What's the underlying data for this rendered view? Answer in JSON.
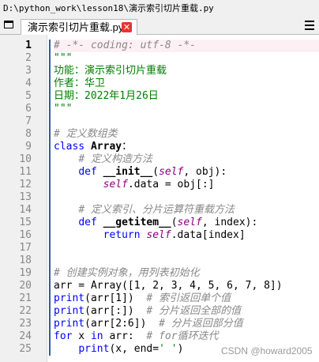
{
  "window": {
    "title": "D:\\python_work\\lesson18\\演示索引切片重载.py"
  },
  "tab": {
    "label": "演示索引切片重载.py",
    "close_glyph": "✕"
  },
  "colors": {
    "keyword": "#0000ff",
    "comment": "#888888",
    "string": "#008000",
    "self": "#8b0082",
    "current_line_bg": "#fdf0f5"
  },
  "icons": {
    "doclist": "document-list-icon",
    "menu": "hamburger-menu-icon",
    "close": "close-icon"
  },
  "editor": {
    "current_line": 1,
    "lines": [
      {
        "n": "1",
        "t": [
          [
            "cm",
            "# -*- coding: utf-8 -*-"
          ]
        ]
      },
      {
        "n": "2",
        "t": [
          [
            "st",
            "\"\"\""
          ]
        ]
      },
      {
        "n": "3",
        "t": [
          [
            "st",
            "功能：演示索引切片重载"
          ]
        ]
      },
      {
        "n": "4",
        "t": [
          [
            "st",
            "作者：华卫"
          ]
        ]
      },
      {
        "n": "5",
        "t": [
          [
            "st",
            "日期：2022年1月26日"
          ]
        ]
      },
      {
        "n": "6",
        "t": [
          [
            "st",
            "\"\"\""
          ]
        ]
      },
      {
        "n": "7",
        "t": []
      },
      {
        "n": "8",
        "t": [
          [
            "cm",
            "# 定义数组类"
          ]
        ]
      },
      {
        "n": "9",
        "t": [
          [
            "kw",
            "class "
          ],
          [
            "dn",
            "Array"
          ],
          [
            "",
            "："
          ]
        ]
      },
      {
        "n": "10",
        "t": [
          [
            "",
            "    "
          ],
          [
            "cm",
            "# 定义构造方法"
          ]
        ]
      },
      {
        "n": "11",
        "t": [
          [
            "",
            "    "
          ],
          [
            "kw",
            "def "
          ],
          [
            "dn",
            "__init__"
          ],
          [
            "",
            "("
          ],
          [
            "se",
            "self"
          ],
          [
            "",
            ", obj):"
          ]
        ]
      },
      {
        "n": "12",
        "t": [
          [
            "",
            "        "
          ],
          [
            "se",
            "self"
          ],
          [
            "",
            ".data = obj[:]"
          ]
        ]
      },
      {
        "n": "13",
        "t": []
      },
      {
        "n": "14",
        "t": [
          [
            "",
            "    "
          ],
          [
            "cm",
            "# 定义索引、分片运算符重载方法"
          ]
        ]
      },
      {
        "n": "15",
        "t": [
          [
            "",
            "    "
          ],
          [
            "kw",
            "def "
          ],
          [
            "dn",
            "__getitem__"
          ],
          [
            "",
            "("
          ],
          [
            "se",
            "self"
          ],
          [
            "",
            ", index):"
          ]
        ]
      },
      {
        "n": "16",
        "t": [
          [
            "",
            "        "
          ],
          [
            "kw",
            "return "
          ],
          [
            "se",
            "self"
          ],
          [
            "",
            ".data[index]"
          ]
        ]
      },
      {
        "n": "17",
        "t": []
      },
      {
        "n": "18",
        "t": []
      },
      {
        "n": "19",
        "t": [
          [
            "cm",
            "# 创建实例对象，用列表初始化"
          ]
        ]
      },
      {
        "n": "20",
        "t": [
          [
            "",
            "arr = Array([1, 2, 3, 4, 5, 6, 7, 8])"
          ]
        ]
      },
      {
        "n": "21",
        "t": [
          [
            "bl",
            "print"
          ],
          [
            "",
            "(arr[1])  "
          ],
          [
            "cm",
            "# 索引返回单个值"
          ]
        ]
      },
      {
        "n": "22",
        "t": [
          [
            "bl",
            "print"
          ],
          [
            "",
            "(arr[:])  "
          ],
          [
            "cm",
            "# 分片返回全部的值"
          ]
        ]
      },
      {
        "n": "23",
        "t": [
          [
            "bl",
            "print"
          ],
          [
            "",
            "(arr[2:6])  "
          ],
          [
            "cm",
            "# 分片返回部分值"
          ]
        ]
      },
      {
        "n": "24",
        "t": [
          [
            "kw",
            "for"
          ],
          [
            "",
            " x "
          ],
          [
            "kw",
            "in"
          ],
          [
            "",
            " arr:  "
          ],
          [
            "cm",
            "# for循环迭代"
          ]
        ]
      },
      {
        "n": "25",
        "t": [
          [
            "",
            "    "
          ],
          [
            "bl",
            "print"
          ],
          [
            "",
            "(x, end="
          ],
          [
            "st",
            "' '"
          ],
          [
            "",
            ")"
          ]
        ]
      }
    ]
  },
  "watermark": "CSDN @howard2005"
}
